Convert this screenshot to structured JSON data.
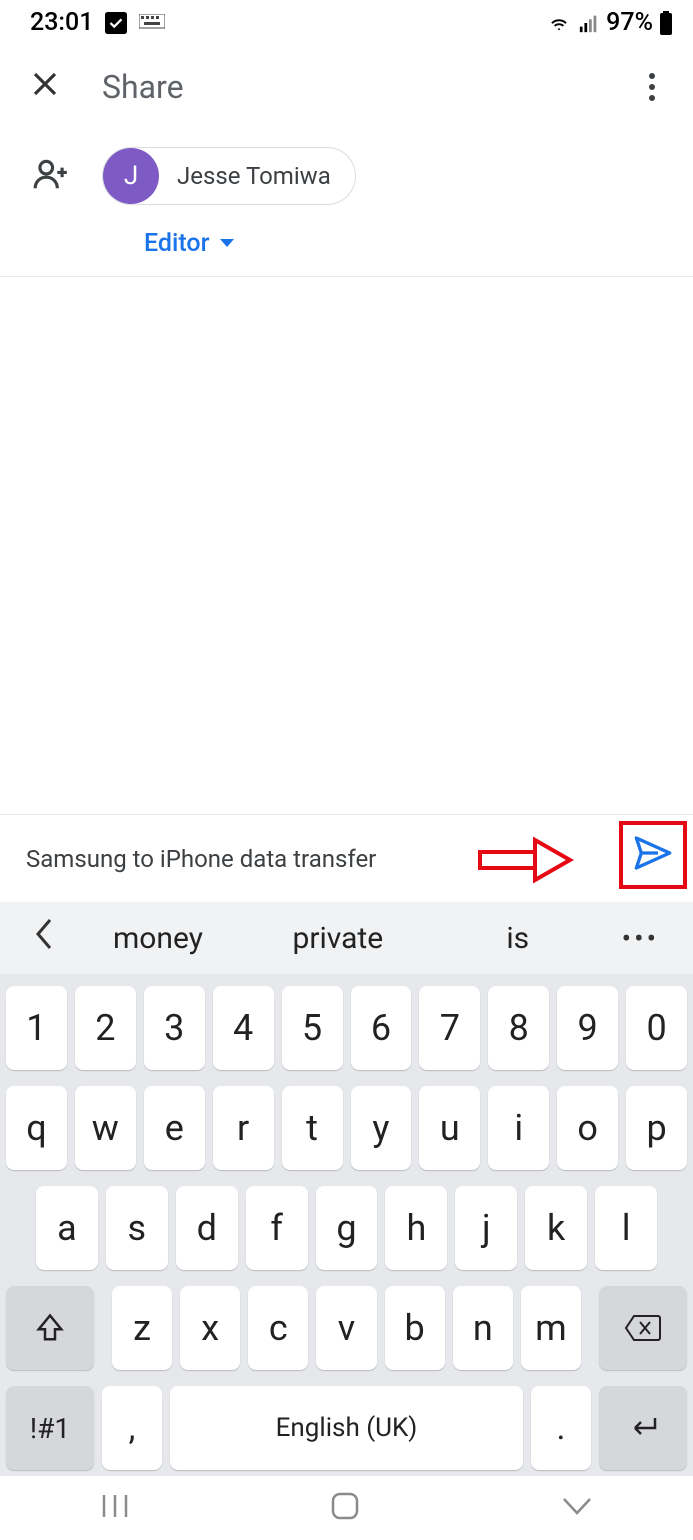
{
  "status": {
    "time": "23:01",
    "battery": "97%"
  },
  "header": {
    "title": "Share"
  },
  "contact": {
    "initial": "J",
    "name": "Jesse Tomiwa"
  },
  "permission": {
    "label": "Editor"
  },
  "message": {
    "text": "Samsung to iPhone data transfer"
  },
  "suggestions": {
    "w1": "money",
    "w2": "private",
    "w3": "is"
  },
  "keyboard": {
    "row0": [
      "1",
      "2",
      "3",
      "4",
      "5",
      "6",
      "7",
      "8",
      "9",
      "0"
    ],
    "row1": [
      "q",
      "w",
      "e",
      "r",
      "t",
      "y",
      "u",
      "i",
      "o",
      "p"
    ],
    "row2": [
      "a",
      "s",
      "d",
      "f",
      "g",
      "h",
      "j",
      "k",
      "l"
    ],
    "row3": [
      "z",
      "x",
      "c",
      "v",
      "b",
      "n",
      "m"
    ],
    "sym": "!#1",
    "comma": ",",
    "space": "English (UK)",
    "period": "."
  }
}
